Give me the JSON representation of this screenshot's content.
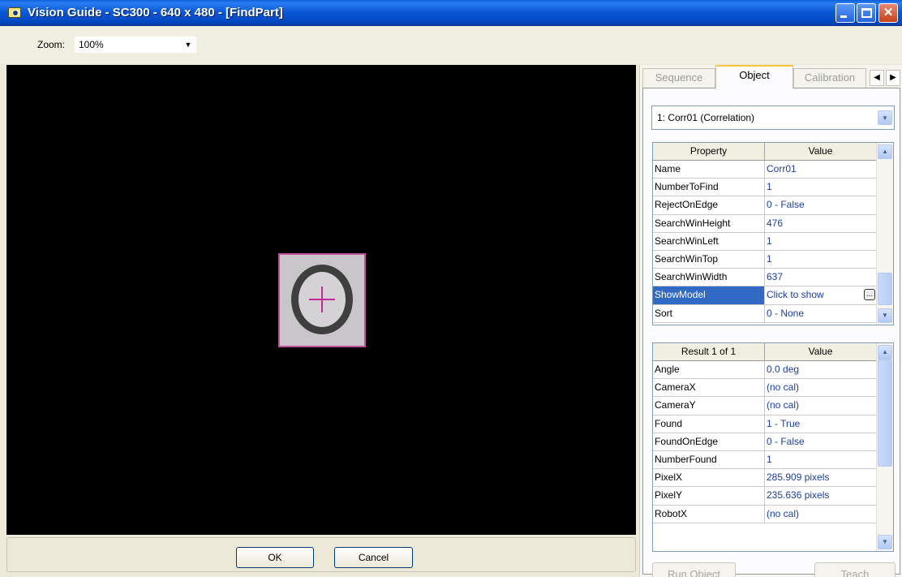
{
  "window": {
    "title": "Vision Guide - SC300 - 640 x 480 - [FindPart]",
    "controls": [
      "minimize-icon",
      "maximize-icon",
      "close-icon"
    ]
  },
  "toolbar": {
    "zoom_label": "Zoom:",
    "zoom_value": "100%"
  },
  "image": {
    "crosshair_color": "#c22c9a",
    "model_border_color": "#c2509f"
  },
  "footer": {
    "ok_label": "OK",
    "cancel_label": "Cancel"
  },
  "tabs": {
    "sequence": "Sequence",
    "object": "Object",
    "calibration": "Calibration",
    "active": "Object"
  },
  "object_select": {
    "value": "1:  Corr01 (Correlation)"
  },
  "properties": {
    "header_property": "Property",
    "header_value": "Value",
    "rows": [
      {
        "name": "Name",
        "value": "Corr01"
      },
      {
        "name": "NumberToFind",
        "value": "1"
      },
      {
        "name": "RejectOnEdge",
        "value": "0 - False"
      },
      {
        "name": "SearchWinHeight",
        "value": "476"
      },
      {
        "name": "SearchWinLeft",
        "value": "1"
      },
      {
        "name": "SearchWinTop",
        "value": "1"
      },
      {
        "name": "SearchWinWidth",
        "value": "637"
      },
      {
        "name": "ShowModel",
        "value": "Click to show"
      },
      {
        "name": "Sort",
        "value": "0 - None"
      }
    ],
    "selected_row": "ShowModel"
  },
  "results": {
    "header_result": "Result 1 of 1",
    "header_value": "Value",
    "rows": [
      {
        "name": "Angle",
        "value": "0.0 deg"
      },
      {
        "name": "CameraX",
        "value": "(no cal)"
      },
      {
        "name": "CameraY",
        "value": "(no cal)"
      },
      {
        "name": "Found",
        "value": "1 - True"
      },
      {
        "name": "FoundOnEdge",
        "value": "0 - False"
      },
      {
        "name": "NumberFound",
        "value": "1"
      },
      {
        "name": "PixelX",
        "value": "285.909 pixels"
      },
      {
        "name": "PixelY",
        "value": "235.636 pixels"
      },
      {
        "name": "RobotX",
        "value": "(no cal)"
      }
    ]
  },
  "actions": {
    "run_object": "Run Object",
    "teach": "Teach"
  },
  "colors": {
    "title_bar": "#0857d5",
    "selection": "#316ac5",
    "value_text": "#1c3fa0"
  }
}
